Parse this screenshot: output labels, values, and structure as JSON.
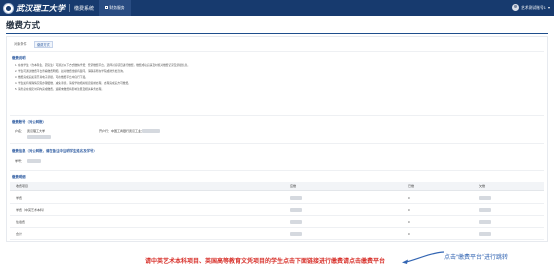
{
  "header": {
    "logo_name": "武汉理工大学",
    "system_name": "缴费系统",
    "nav_home": "财务服务",
    "user_name": "艺术测试账号1"
  },
  "page": {
    "title": "缴费方式"
  },
  "tabs": [
    {
      "label": "对象条件"
    },
    {
      "label": "缴费方式"
    }
  ],
  "notice": {
    "heading": "缴费说明",
    "lines": [
      "1. 在校学生（含本科生、研究生）可通过以下方式缴纳学费：登录缴费平台，选择对应项目进行缴费，缴费成功后请及时核对缴费记录及票据信息。",
      "2. 学生可通过缴费平台查看缴费明细，如对缴费金额有疑问，请联系所在学院或财务处咨询。",
      "3. 缴费完成后如需开具电子票据，可在缴费平台中自行下载。",
      "4. 学生如有特殊情况需办理缓缴、减免手续，请按学校相关规定提前办理，办理完成后方可缴费。",
      "5. 请务必在规定时间内完成缴费，逾期未缴费将影响注册及相关事务办理。"
    ]
  },
  "bank_info": {
    "heading": "缴费账号（对公转账）",
    "account_label": "户名：",
    "account_value": "武汉理工大学",
    "bank_label": "开户行：",
    "bank_value": "中国工商银行武汉工业大学支行"
  },
  "pay_info": {
    "heading": "缴费信息（对公转账，请在备注中注明学生姓名及学号）",
    "number_label": "学号："
  },
  "table": {
    "heading": "缴费明细",
    "columns": [
      "收费项目",
      "应缴",
      "已缴",
      "欠缴"
    ],
    "rows": [
      {
        "item": "学费",
        "due": "",
        "paid": "0",
        "owed": ""
      },
      {
        "item": "学费（中英艺术本科）",
        "due": "",
        "paid": "0",
        "owed": ""
      },
      {
        "item": "住宿费",
        "due": "",
        "paid": "0",
        "owed": ""
      },
      {
        "item": "合计",
        "due": "",
        "paid": "0",
        "owed": ""
      }
    ]
  },
  "callout": {
    "main": "请中英艺术本科项目、英国高等教育文凭项目的学生点击下面链接进行缴费",
    "link": "请点击缴费平台",
    "right": "点击“缴费平台”进行跳转"
  },
  "colors": {
    "header_bg": "#173a6e",
    "accent": "#2c5aa0",
    "callout_red": "#d8322c",
    "callout_blue": "#3466b3"
  }
}
